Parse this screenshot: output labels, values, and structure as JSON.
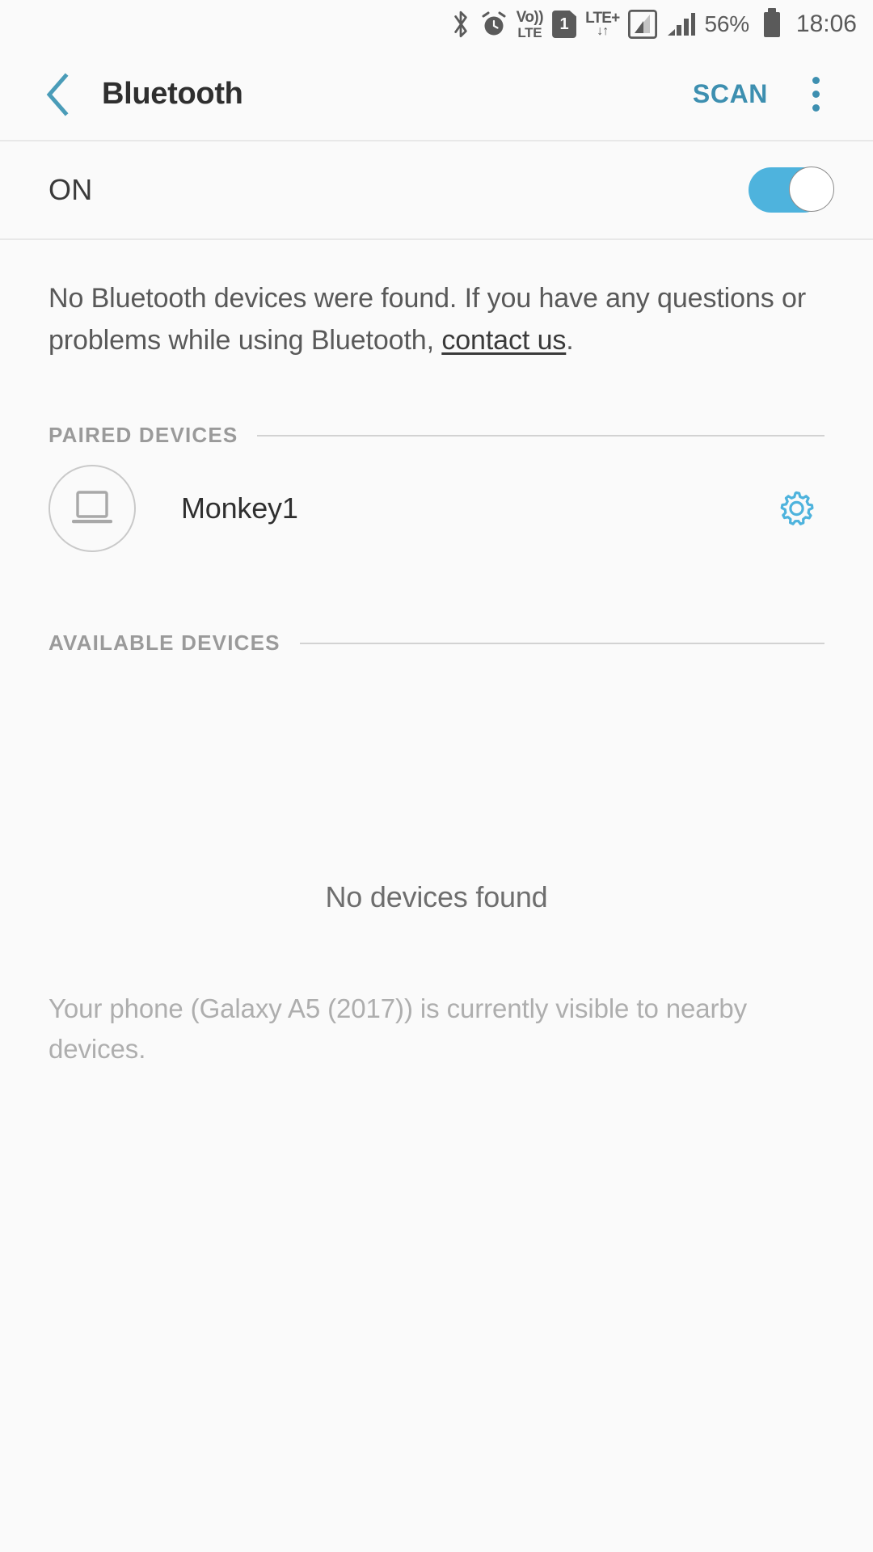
{
  "statusbar": {
    "icons": [
      {
        "name": "bluetooth-icon",
        "glyph": "bluetooth"
      },
      {
        "name": "alarm-icon",
        "glyph": "alarm"
      },
      {
        "name": "volte-icon",
        "top": "Vo))",
        "bottom": "LTE"
      },
      {
        "name": "sim-1-icon",
        "label": "1"
      },
      {
        "name": "lte-plus-data-icon",
        "top": "LTE+",
        "arrows": "↓↑"
      },
      {
        "name": "signal-sim1-icon",
        "glyph": "signal-boxed"
      },
      {
        "name": "signal-sim2-icon",
        "glyph": "signal-bars"
      }
    ],
    "battery_percent": "56%",
    "clock": "18:06"
  },
  "appbar": {
    "back_label": "Back",
    "title": "Bluetooth",
    "scan_label": "SCAN",
    "overflow_label": "More options"
  },
  "power_row": {
    "state_label": "ON",
    "toggle_on": true
  },
  "info": {
    "text_before": "No Bluetooth devices were found. If you have any questions or problems while using Bluetooth, ",
    "link_text": "contact us",
    "text_after": "."
  },
  "paired_section": {
    "header": "PAIRED DEVICES",
    "devices": [
      {
        "name": "Monkey1",
        "icon": "laptop-icon",
        "settings_icon": "gear-icon"
      }
    ]
  },
  "available_section": {
    "header": "AVAILABLE DEVICES",
    "empty_message": "No devices found"
  },
  "footer": {
    "visibility_note": "Your phone (Galaxy A5 (2017)) is currently visible to nearby devices."
  },
  "colors": {
    "accent": "#3d8fb0",
    "toggle_on": "#4eb3dd",
    "background": "#fafafa",
    "primary_text": "#2f2f2f",
    "secondary_text": "#9a9a9a"
  }
}
